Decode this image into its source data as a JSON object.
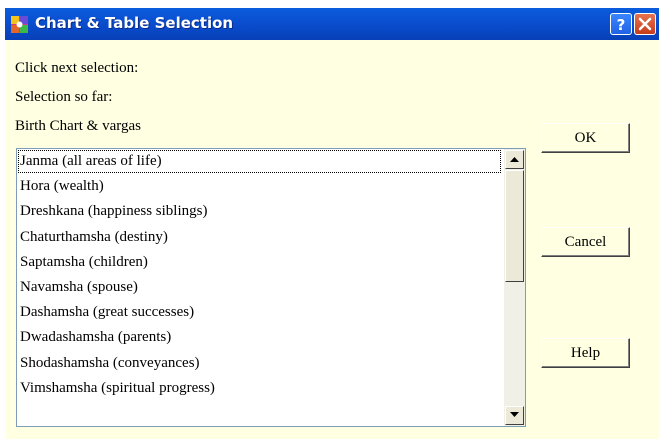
{
  "window": {
    "title": "Chart & Table Selection",
    "title_bar_color": "#0a4ecf",
    "background_color": "#ffffe1",
    "app_icon": "colorful-app-icon",
    "help_button_icon": "question-icon",
    "close_button_icon": "close-icon"
  },
  "labels": {
    "prompt": "Click next selection:",
    "selection_so_far": "Selection so far:",
    "current_selection": "Birth Chart & vargas"
  },
  "list": {
    "items": [
      "Janma (all areas of life)",
      "Hora (wealth)",
      "Dreshkana (happiness siblings)",
      "Chaturthamsha (destiny)",
      "Saptamsha (children)",
      "Navamsha (spouse)",
      "Dashamsha (great successes)",
      "Dwadashamsha (parents)",
      "Shodashamsha (conveyances)",
      "Vimshamsha (spiritual progress)"
    ],
    "focused_index": 0
  },
  "buttons": {
    "ok": "OK",
    "cancel": "Cancel",
    "help": "Help"
  }
}
